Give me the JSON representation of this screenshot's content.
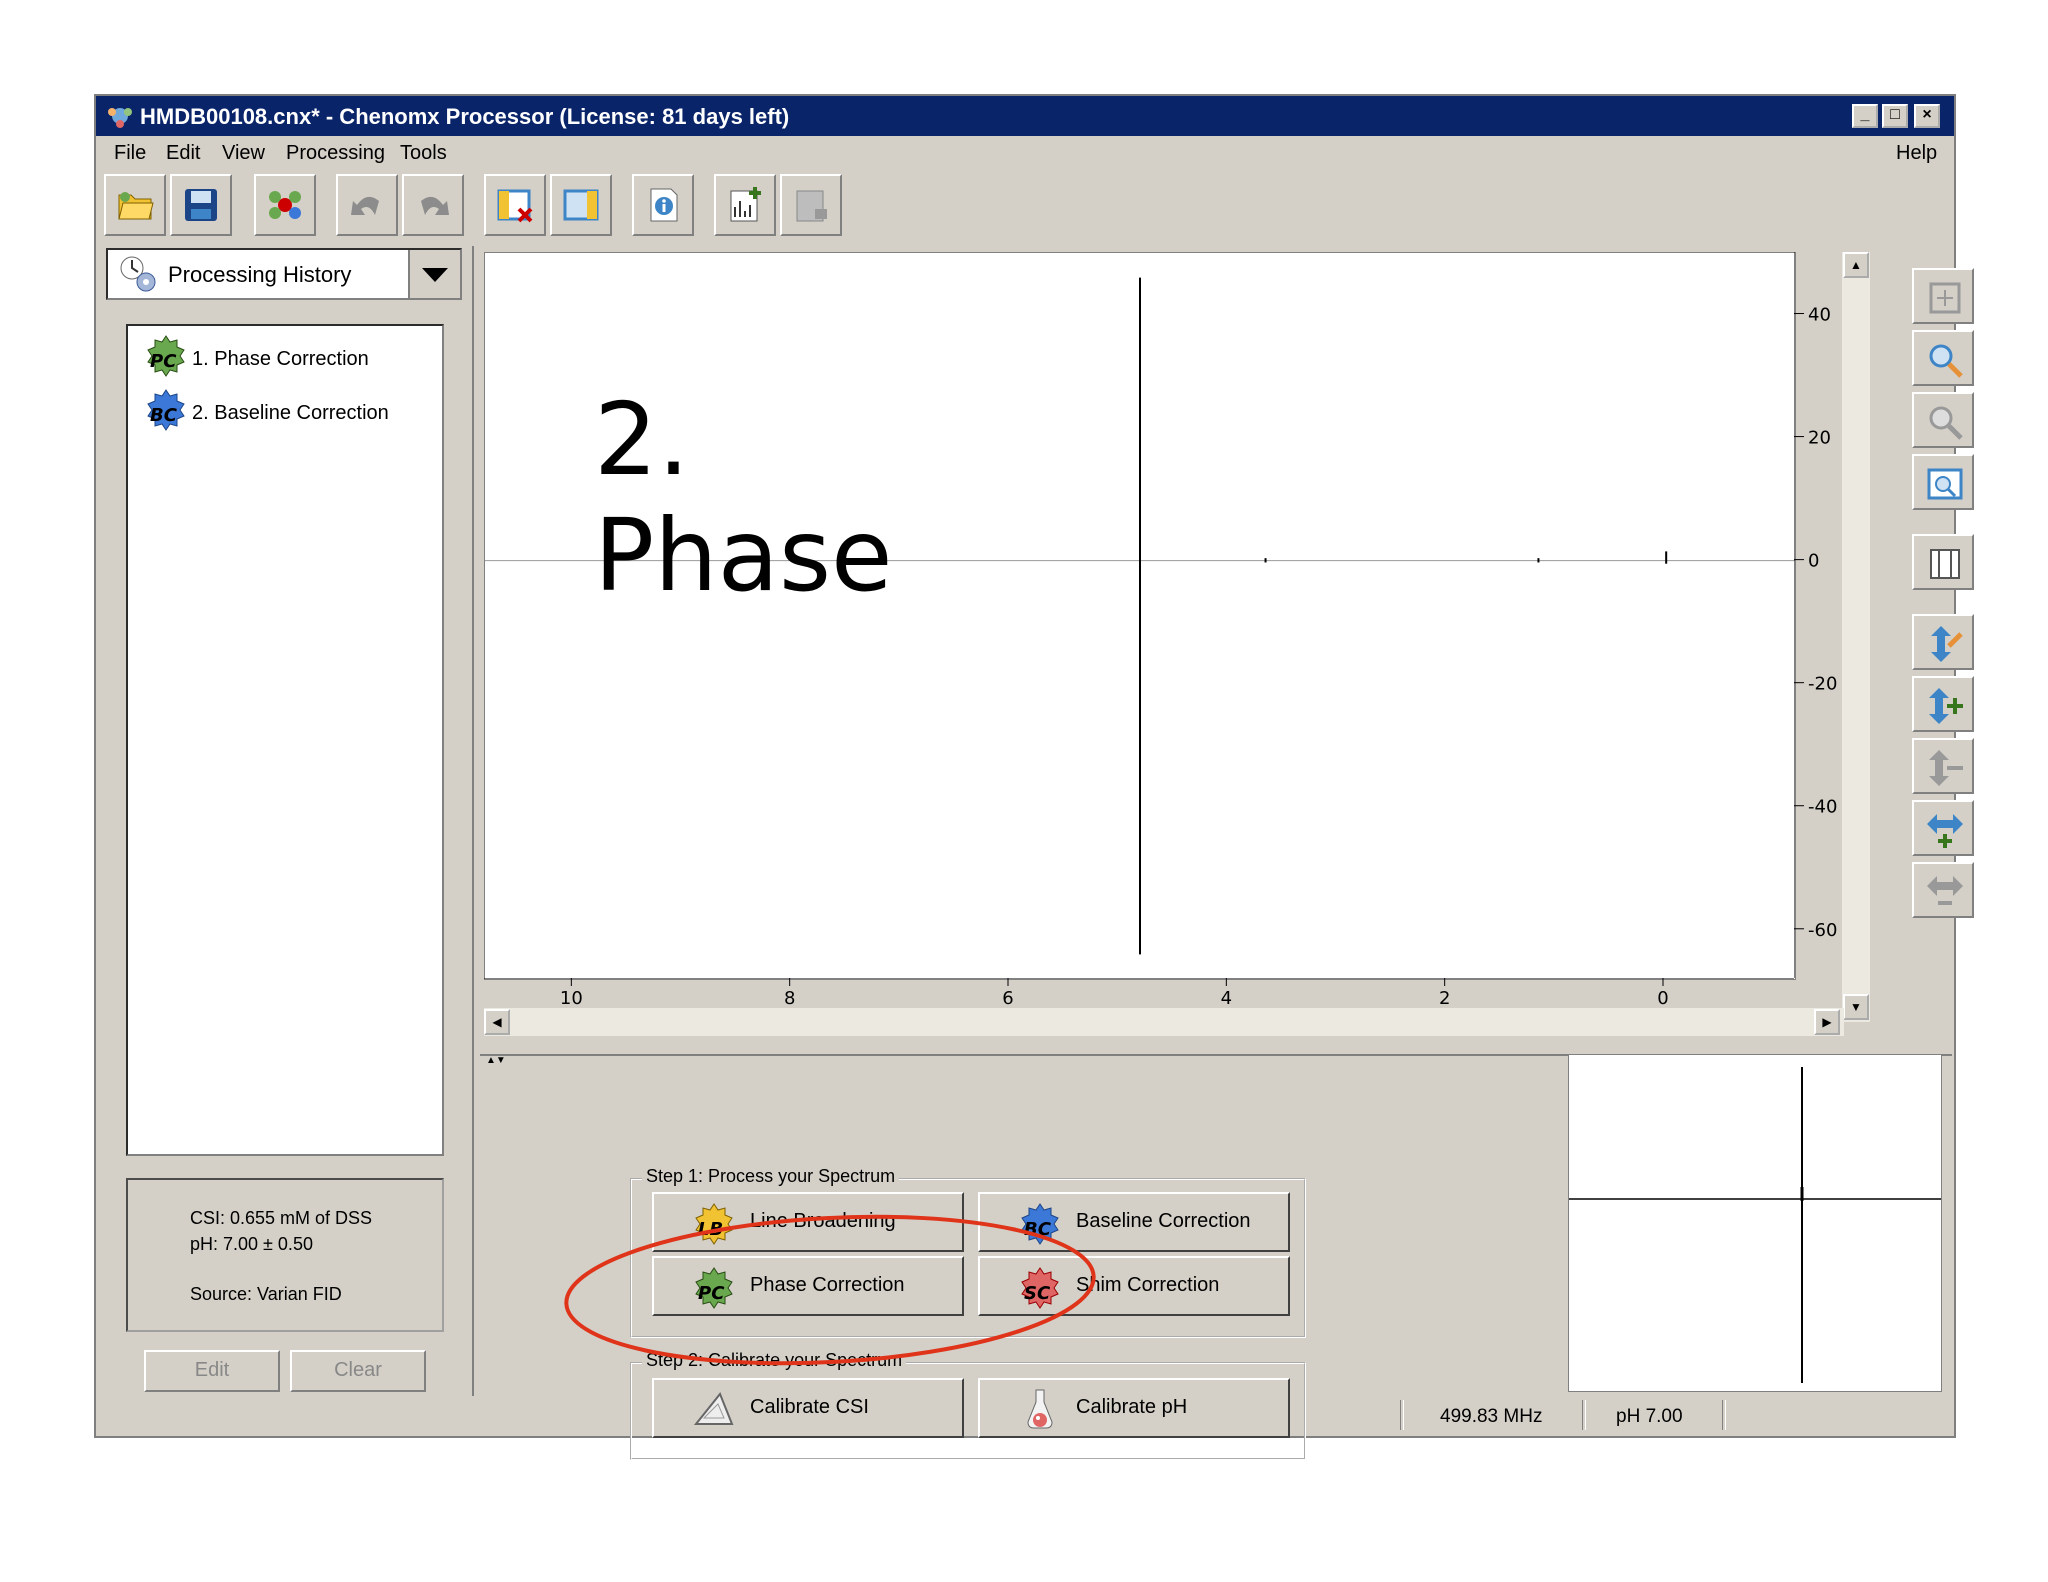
{
  "window": {
    "title": "HMDB00108.cnx* - Chenomx Processor (License: 81 days left)",
    "controls": [
      "_",
      "□",
      "×"
    ]
  },
  "menu": {
    "items": [
      "File",
      "Edit",
      "View",
      "Processing",
      "Tools"
    ],
    "help": "Help"
  },
  "toolbar": {
    "buttons": [
      "open-icon",
      "save-icon",
      "molecule-icon",
      "undo-icon",
      "redo-icon",
      "remove-panel-icon",
      "split-panel-icon",
      "info-icon",
      "add-spectrum-icon",
      "remove-spectrum-icon"
    ]
  },
  "sidebar": {
    "combo_label": "Processing History",
    "history": [
      {
        "icon": "PC",
        "label": "1.  Phase Correction"
      },
      {
        "icon": "BC",
        "label": "2.  Baseline Correction"
      }
    ],
    "info": {
      "csi": "CSI: 0.655 mM of DSS",
      "ph": "pH: 7.00 ± 0.50",
      "source": "Source: Varian FID"
    },
    "edit_label": "Edit",
    "clear_label": "Clear"
  },
  "overlay": {
    "text": "2.\nPhase"
  },
  "chart_data": {
    "type": "line",
    "x_ticks": [
      "10",
      "8",
      "6",
      "4",
      "2",
      "0"
    ],
    "y_ticks": [
      "40",
      "20",
      "0",
      "-20",
      "-40",
      "-60"
    ],
    "xlim": [
      10.8,
      -1.2
    ],
    "ylim": [
      -68,
      50
    ],
    "peaks": [
      {
        "x": 4.8,
        "y_max": 46,
        "y_min": -64
      },
      {
        "x": 3.65,
        "y_max": 0.4,
        "y_min": -0.3
      },
      {
        "x": 1.15,
        "y_max": 0.4,
        "y_min": -0.3
      },
      {
        "x": -0.02,
        "y_max": 1.5,
        "y_min": -0.5
      }
    ]
  },
  "steps": {
    "step1_title": "Step 1: Process your Spectrum",
    "step2_title": "Step 2: Calibrate your Spectrum",
    "buttons": {
      "line_broadening": "Line Broadening",
      "baseline_correction": "Baseline Correction",
      "phase_correction": "Phase Correction",
      "shim_correction": "Shim Correction",
      "calibrate_csi": "Calibrate CSI",
      "calibrate_ph": "Calibrate pH"
    },
    "icons": {
      "lb": "LB",
      "bc": "BC",
      "pc": "PC",
      "sc": "SC"
    }
  },
  "status": {
    "frequency": "499.83 MHz",
    "ph": "pH 7.00"
  },
  "colors": {
    "titlebar": "#0a246a",
    "highlight": "#e0341a",
    "face": "#d4d0c8"
  }
}
